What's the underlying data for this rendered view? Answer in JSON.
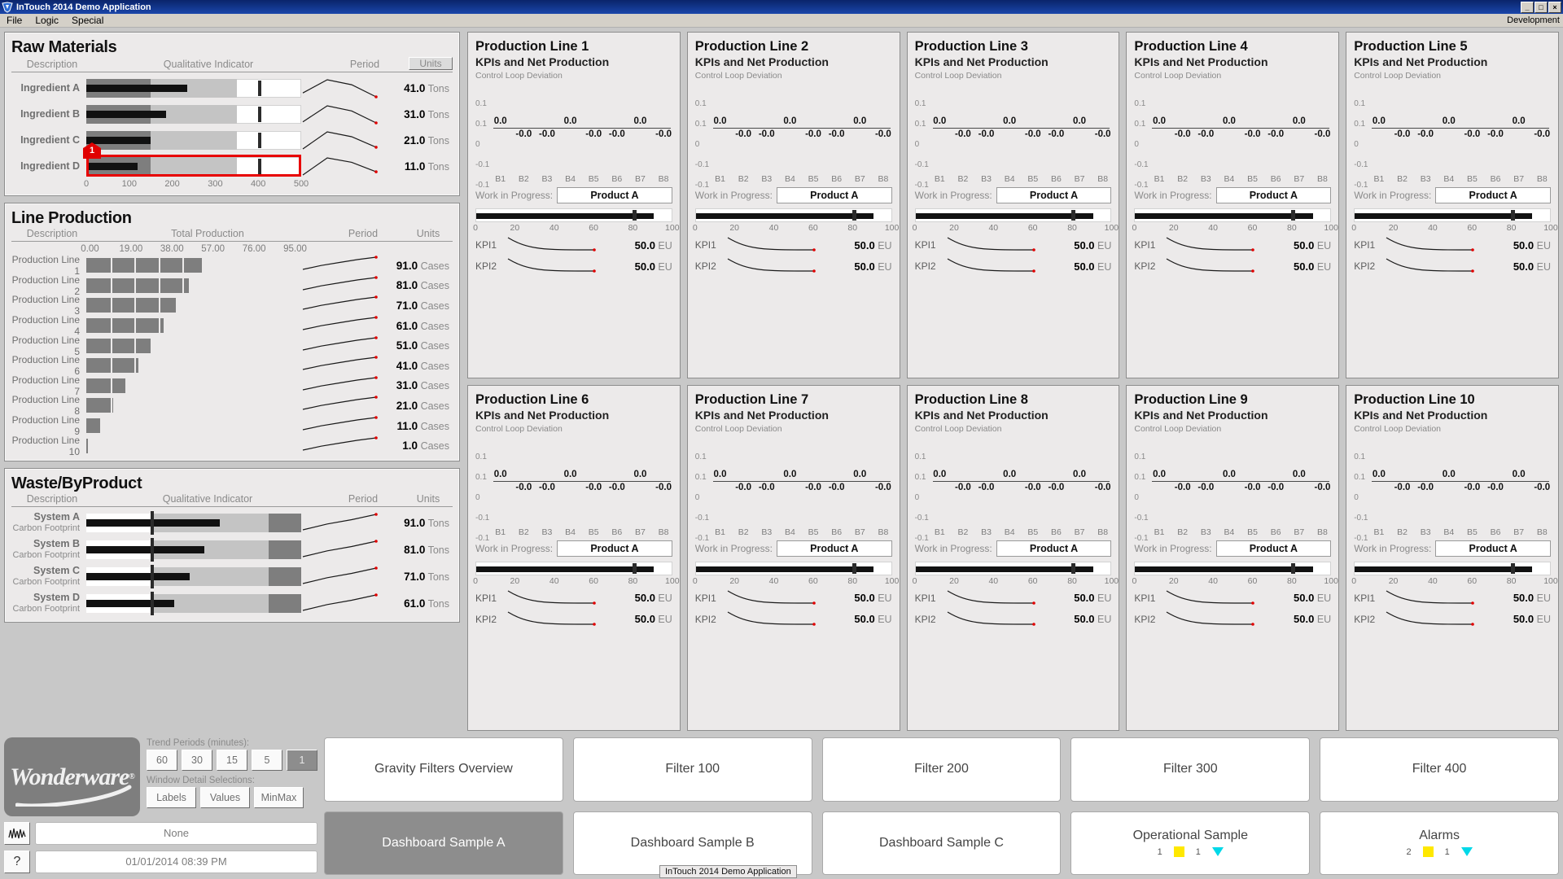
{
  "window": {
    "title": "InTouch 2014 Demo Application",
    "icon": "intouch-logo-icon",
    "minimize": "_",
    "maximize": "□",
    "close": "×"
  },
  "menubar": {
    "items": [
      "File",
      "Logic",
      "Special"
    ],
    "right_label": "Development"
  },
  "raw_materials": {
    "title": "Raw Materials",
    "headers": {
      "description": "Description",
      "indicator": "Qualitative Indicator",
      "period": "Period",
      "units": "Units"
    },
    "axis": [
      "0",
      "100",
      "200",
      "300",
      "400",
      "500"
    ],
    "axis_min": 0,
    "axis_max": 500,
    "rows": [
      {
        "label": "Ingredient A",
        "value": 235,
        "target": 400,
        "band_dark": 150,
        "band_mid": 350,
        "display": "41.0",
        "unit": "Tons",
        "spark": [
          30,
          70,
          55,
          18
        ]
      },
      {
        "label": "Ingredient B",
        "value": 185,
        "target": 400,
        "band_dark": 150,
        "band_mid": 350,
        "display": "31.0",
        "unit": "Tons",
        "spark": [
          28,
          72,
          58,
          25
        ]
      },
      {
        "label": "Ingredient C",
        "value": 150,
        "target": 400,
        "band_dark": 150,
        "band_mid": 350,
        "display": "21.0",
        "unit": "Tons",
        "spark": [
          25,
          74,
          60,
          30
        ]
      },
      {
        "label": "Ingredient D",
        "value": 120,
        "target": 400,
        "band_dark": 150,
        "band_mid": 350,
        "display": "11.0",
        "unit": "Tons",
        "spark": [
          22,
          76,
          62,
          32
        ],
        "alert": true
      }
    ],
    "alert_badge": "1"
  },
  "line_production": {
    "title": "Line Production",
    "headers": {
      "description": "Description",
      "total": "Total Production",
      "period": "Period",
      "units": "Units"
    },
    "axis": [
      "0.00",
      "19.00",
      "38.00",
      "57.00",
      "76.00",
      "95.00"
    ],
    "axis_min": 0,
    "axis_max": 95,
    "rows": [
      {
        "label": "Production Line 1",
        "value": 91,
        "display": "91.0",
        "unit": "Cases"
      },
      {
        "label": "Production Line 2",
        "value": 81,
        "display": "81.0",
        "unit": "Cases"
      },
      {
        "label": "Production Line 3",
        "value": 71,
        "display": "71.0",
        "unit": "Cases"
      },
      {
        "label": "Production Line 4",
        "value": 61,
        "display": "61.0",
        "unit": "Cases"
      },
      {
        "label": "Production Line 5",
        "value": 51,
        "display": "51.0",
        "unit": "Cases"
      },
      {
        "label": "Production Line 6",
        "value": 41,
        "display": "41.0",
        "unit": "Cases"
      },
      {
        "label": "Production Line 7",
        "value": 31,
        "display": "31.0",
        "unit": "Cases"
      },
      {
        "label": "Production Line 8",
        "value": 21,
        "display": "21.0",
        "unit": "Cases"
      },
      {
        "label": "Production Line 9",
        "value": 11,
        "display": "11.0",
        "unit": "Cases"
      },
      {
        "label": "Production Line 10",
        "value": 1,
        "display": "1.0",
        "unit": "Cases"
      }
    ]
  },
  "waste_byproduct": {
    "title": "Waste/ByProduct",
    "headers": {
      "description": "Description",
      "indicator": "Qualitative Indicator",
      "period": "Period",
      "units": "Units"
    },
    "rows": [
      {
        "label": "System A",
        "sublabel": "Carbon Footprint",
        "value": 62,
        "target": 30,
        "band_light": 30,
        "band_mid": 85,
        "display": "91.0",
        "unit": "Tons"
      },
      {
        "label": "System B",
        "sublabel": "Carbon Footprint",
        "value": 55,
        "target": 30,
        "band_light": 30,
        "band_mid": 85,
        "display": "81.0",
        "unit": "Tons"
      },
      {
        "label": "System C",
        "sublabel": "Carbon Footprint",
        "value": 48,
        "target": 30,
        "band_light": 30,
        "band_mid": 85,
        "display": "71.0",
        "unit": "Tons"
      },
      {
        "label": "System D",
        "sublabel": "Carbon Footprint",
        "value": 41,
        "target": 30,
        "band_light": 30,
        "band_mid": 85,
        "display": "61.0",
        "unit": "Tons"
      }
    ]
  },
  "production_lines": {
    "subtitle": "KPIs and Net Production",
    "chart_caption": "Control Loop Deviation",
    "wip_label": "Work in Progress:",
    "wip_value": "Product A",
    "kpi1_label": "KPI1",
    "kpi2_label": "KPI2",
    "kpi1_value": "50.0",
    "kpi2_value": "50.0",
    "kpi_unit": "EU",
    "progress_value": 91,
    "progress_target": 80,
    "cards": [
      {
        "title": "Production Line 1"
      },
      {
        "title": "Production Line 2"
      },
      {
        "title": "Production Line 3"
      },
      {
        "title": "Production Line 4"
      },
      {
        "title": "Production Line 5"
      },
      {
        "title": "Production Line 6"
      },
      {
        "title": "Production Line 7"
      },
      {
        "title": "Production Line 8"
      },
      {
        "title": "Production Line 9"
      },
      {
        "title": "Production Line 10"
      }
    ]
  },
  "chart_data": {
    "type": "bar",
    "title": "Control Loop Deviation",
    "categories": [
      "B1",
      "B2",
      "B3",
      "B4",
      "B5",
      "B6",
      "B7",
      "B8"
    ],
    "values": [
      0.0,
      -0.0,
      -0.0,
      0.0,
      -0.0,
      -0.0,
      0.0,
      -0.0
    ],
    "labels": [
      "0.0",
      "-0.0",
      "-0.0",
      "0.0",
      "-0.0",
      "-0.0",
      "0.0",
      "-0.0"
    ],
    "ytick_labels": [
      "0.1",
      "0.1",
      "0",
      "-0.1",
      "-0.1"
    ],
    "ylim": [
      -0.1,
      0.1
    ],
    "xlabel": "",
    "ylabel": "",
    "grid": false,
    "legend": "none"
  },
  "progress_axis": [
    "0",
    "20",
    "40",
    "60",
    "80",
    "100"
  ],
  "toolbar": {
    "trend_label": "Trend Periods (minutes):",
    "trend_buttons": [
      "60",
      "30",
      "15",
      "5",
      "1"
    ],
    "trend_selected": "1",
    "detail_label": "Window Detail Selections:",
    "detail_buttons": [
      "Labels",
      "Values",
      "MinMax"
    ],
    "alarm_icon": "waveform-icon",
    "help_icon": "?",
    "status_value": "None",
    "datetime_value": "01/01/2014 08:39 PM",
    "logo_text": "Wonderware",
    "logo_reg": "®"
  },
  "nav": {
    "buttons": [
      {
        "label": "Gravity Filters Overview",
        "selected": false
      },
      {
        "label": "Filter 100",
        "selected": false
      },
      {
        "label": "Filter 200",
        "selected": false
      },
      {
        "label": "Filter 300",
        "selected": false
      },
      {
        "label": "Filter 400",
        "selected": false
      },
      {
        "label": "Dashboard Sample A",
        "selected": true
      },
      {
        "label": "Dashboard Sample B",
        "selected": false
      },
      {
        "label": "Dashboard Sample C",
        "selected": false
      },
      {
        "label": "Operational Sample",
        "selected": false,
        "badges": [
          {
            "count": "1",
            "shape": "square",
            "color": "#ffe800"
          },
          {
            "count": "1",
            "shape": "triangle",
            "color": "#00d8e8"
          }
        ]
      },
      {
        "label": "Alarms",
        "selected": false,
        "badges": [
          {
            "count": "2",
            "shape": "square",
            "color": "#ffe800"
          },
          {
            "count": "1",
            "shape": "triangle",
            "color": "#00d8e8"
          }
        ]
      }
    ]
  },
  "taskbar_tooltip": "InTouch 2014 Demo Application",
  "colors": {
    "accent": "#0a246a",
    "alert": "#e00000",
    "bar": "#7e7e7e",
    "panel_bg": "#eceaea"
  }
}
